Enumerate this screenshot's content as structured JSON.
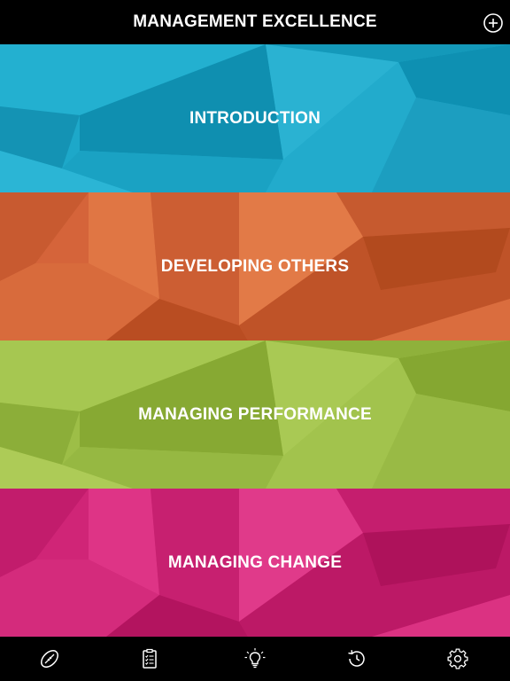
{
  "header": {
    "title": "MANAGEMENT EXCELLENCE",
    "add_icon": "plus-circle-icon"
  },
  "sections": [
    {
      "label": "INTRODUCTION",
      "color": "#1DA8C9"
    },
    {
      "label": "DEVELOPING OTHERS",
      "color": "#D5643A"
    },
    {
      "label": "MANAGING PERFORMANCE",
      "color": "#9DBE47"
    },
    {
      "label": "MANAGING CHANGE",
      "color": "#D02577"
    }
  ],
  "tabbar": {
    "icons": [
      "rugby-ball-icon",
      "clipboard-checklist-icon",
      "lightbulb-icon",
      "history-clock-icon",
      "gear-icon"
    ]
  }
}
